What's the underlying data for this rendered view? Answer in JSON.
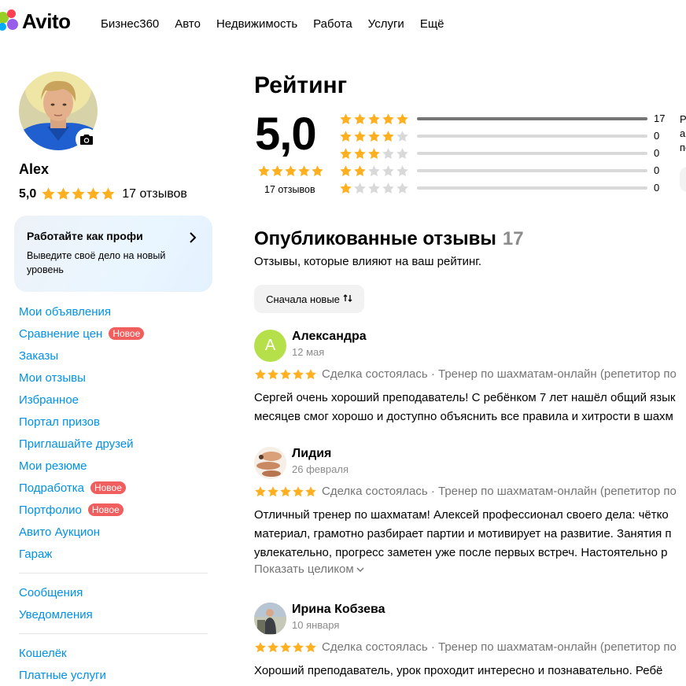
{
  "header": {
    "logo_text": "Avito",
    "nav": [
      "Бизнес360",
      "Авто",
      "Недвижимость",
      "Работа",
      "Услуги",
      "Ещё"
    ]
  },
  "profile": {
    "name": "Alex",
    "rating": "5,0",
    "reviews_count": "17 отзывов"
  },
  "promo": {
    "title": "Работайте как профи",
    "subtitle": "Выведите своё дело на новый уровень"
  },
  "sidebar": {
    "group1": [
      {
        "label": "Мои объявления",
        "badge": ""
      },
      {
        "label": "Сравнение цен",
        "badge": "Новое"
      },
      {
        "label": "Заказы",
        "badge": ""
      },
      {
        "label": "Мои отзывы",
        "badge": ""
      },
      {
        "label": "Избранное",
        "badge": ""
      },
      {
        "label": "Портал призов",
        "badge": ""
      },
      {
        "label": "Приглашайте друзей",
        "badge": ""
      },
      {
        "label": "Мои резюме",
        "badge": ""
      },
      {
        "label": "Подработка",
        "badge": "Новое"
      },
      {
        "label": "Портфолио",
        "badge": "Новое"
      },
      {
        "label": "Авито Аукцион",
        "badge": ""
      },
      {
        "label": "Гараж",
        "badge": ""
      }
    ],
    "group2": [
      {
        "label": "Сообщения",
        "badge": ""
      },
      {
        "label": "Уведомления",
        "badge": ""
      }
    ],
    "group3": [
      {
        "label": "Кошелёк",
        "badge": ""
      },
      {
        "label": "Платные услуги",
        "badge": ""
      }
    ]
  },
  "rating": {
    "title": "Рейтинг",
    "score": "5,0",
    "count_label": "17 отзывов",
    "distribution": [
      {
        "stars": 5,
        "count": "17",
        "fraction": 1.0
      },
      {
        "stars": 4,
        "count": "0",
        "fraction": 0
      },
      {
        "stars": 3,
        "count": "0",
        "fraction": 0
      },
      {
        "stars": 2,
        "count": "0",
        "fraction": 0
      },
      {
        "stars": 1,
        "count": "0",
        "fraction": 0
      }
    ],
    "side_text": [
      "Р",
      "ар",
      "по"
    ]
  },
  "published": {
    "title": "Опубликованные отзывы",
    "count": "17",
    "subtitle": "Отзывы, которые влияют на ваш рейтинг.",
    "sort_label": "Сначала новые"
  },
  "reviews": [
    {
      "name": "Александра",
      "date": "12 мая",
      "avatar_letter": "А",
      "meta": "Сделка состоялась · Тренер по шахматам-онлайн (репетитор по",
      "text": [
        "Сергей очень хороший преподаватель! С ребёнком 7 лет нашёл общий язык",
        "месяцев смог хорошо и доступно объяснить все правила и хитрости в шахм"
      ],
      "more": ""
    },
    {
      "name": "Лидия",
      "date": "26 февраля",
      "avatar_letter": "",
      "meta": "Сделка состоялась · Тренер по шахматам-онлайн (репетитор по",
      "text": [
        "Отличный тренер по шахматам! Алексей профессионал своего дела: чётко",
        "материал, грамотно разбирает партии и мотивирует на развитие. Занятия п",
        "увлекательно, прогресс заметен уже после первых встреч. Настоятельно р"
      ],
      "more": "Показать целиком"
    },
    {
      "name": "Ирина Кобзева",
      "date": "10 января",
      "avatar_letter": "",
      "meta": "Сделка состоялась · Тренер по шахматам-онлайн (репетитор по",
      "text": [
        "Хороший преподаватель, урок проходит интересно и познавательно. Ребё"
      ],
      "more": ""
    }
  ],
  "colors": {
    "star": "#ffb021",
    "star_empty": "#d9d9d9",
    "link": "#0091e6",
    "badge": "#f15e5e"
  }
}
